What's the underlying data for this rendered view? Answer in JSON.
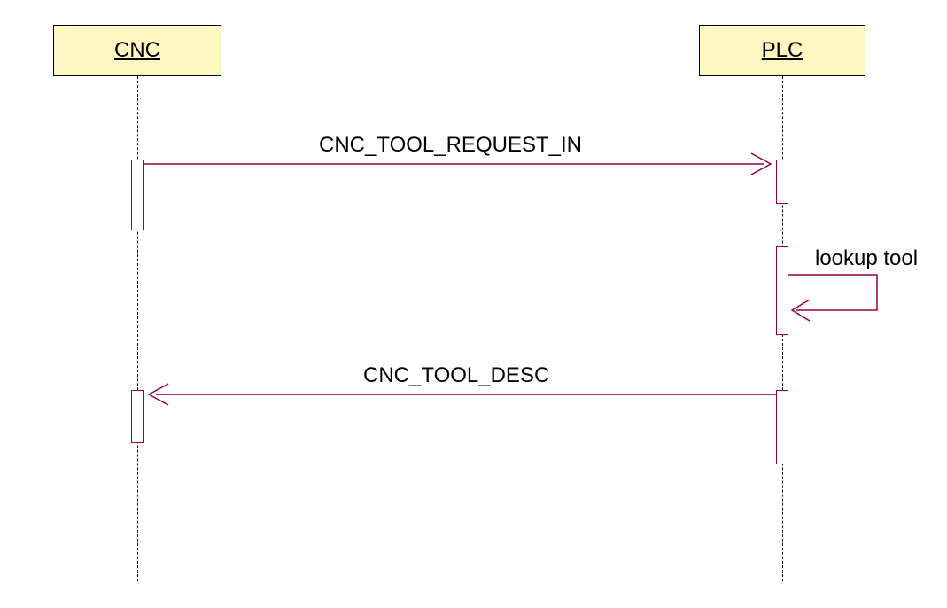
{
  "colors": {
    "line": "#990033",
    "participant_fill": "#fdf8c2"
  },
  "participants": {
    "cnc": {
      "label": "CNC"
    },
    "plc": {
      "label": "PLC"
    }
  },
  "messages": {
    "m1": {
      "label": "CNC_TOOL_REQUEST_IN"
    },
    "m2": {
      "label": "lookup tool"
    },
    "m3": {
      "label": "CNC_TOOL_DESC"
    }
  },
  "chart_data": {
    "type": "sequence_diagram",
    "participants": [
      "CNC",
      "PLC"
    ],
    "events": [
      {
        "from": "CNC",
        "to": "PLC",
        "label": "CNC_TOOL_REQUEST_IN",
        "kind": "message"
      },
      {
        "from": "PLC",
        "to": "PLC",
        "label": "lookup tool",
        "kind": "self-message"
      },
      {
        "from": "PLC",
        "to": "CNC",
        "label": "CNC_TOOL_DESC",
        "kind": "message"
      }
    ],
    "activations": [
      {
        "participant": "CNC",
        "ranges": 2
      },
      {
        "participant": "PLC",
        "ranges": 3
      }
    ]
  }
}
